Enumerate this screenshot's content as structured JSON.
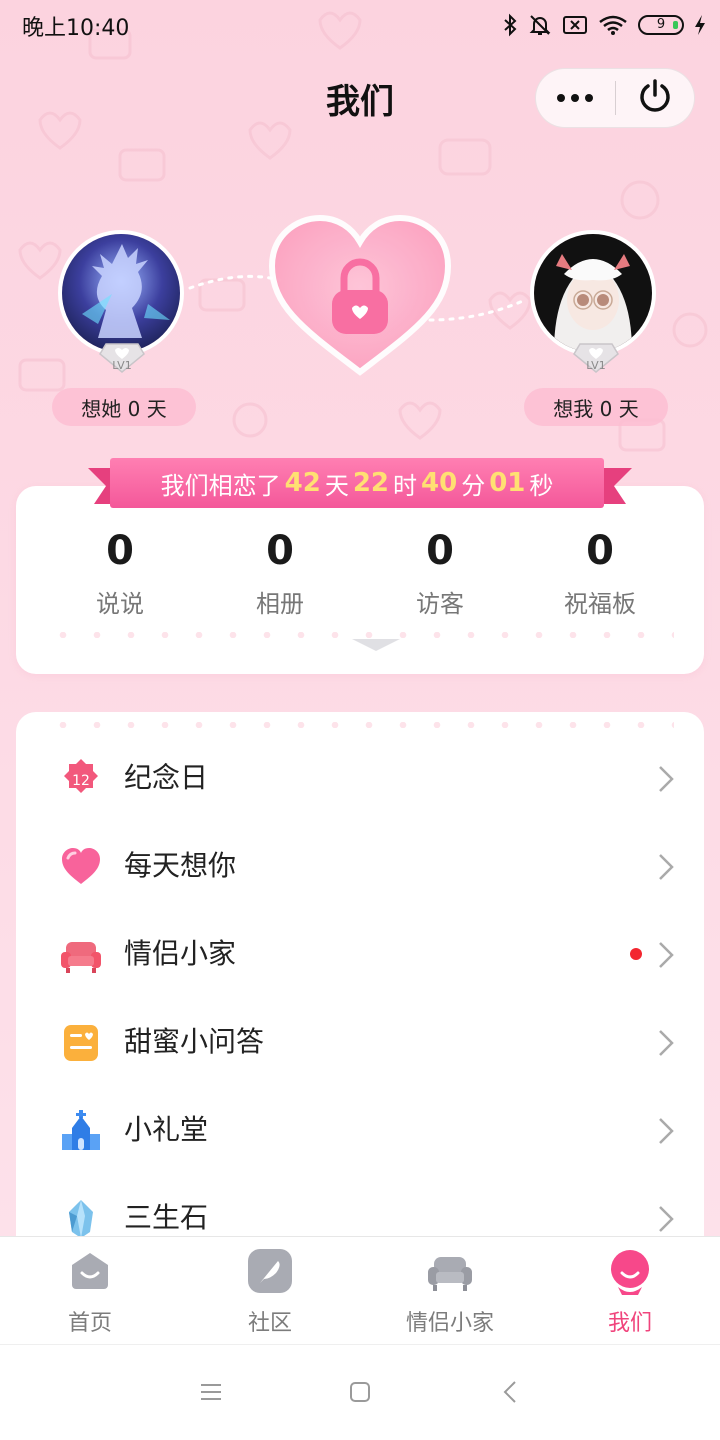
{
  "status_bar": {
    "time": "晚上10:40",
    "battery": "9",
    "icons": [
      "bluetooth-icon",
      "mute-bell-icon",
      "sim-icon",
      "wifi-icon",
      "battery-icon",
      "charging-icon"
    ]
  },
  "header": {
    "title": "我们",
    "more_icon": "more-dots-icon",
    "power_icon": "power-icon"
  },
  "couple": {
    "left": {
      "level": "LV1",
      "days_label": "想她 0 天"
    },
    "right": {
      "level": "LV1",
      "days_label": "想我 0 天"
    },
    "center_icon": "heart-lock-icon"
  },
  "love_timer": {
    "prefix": "我们相恋了",
    "days": "42",
    "days_unit": "天",
    "hours": "22",
    "hours_unit": "时",
    "minutes": "40",
    "minutes_unit": "分",
    "seconds": "01",
    "seconds_unit": "秒"
  },
  "stats": [
    {
      "value": "0",
      "label": "说说"
    },
    {
      "value": "0",
      "label": "相册"
    },
    {
      "value": "0",
      "label": "访客"
    },
    {
      "value": "0",
      "label": "祝福板"
    }
  ],
  "menu": [
    {
      "label": "纪念日",
      "icon": "calendar-12-icon",
      "badge_text": "12"
    },
    {
      "label": "每天想你",
      "icon": "heart-icon"
    },
    {
      "label": "情侣小家",
      "icon": "sofa-icon",
      "has_red_dot": true
    },
    {
      "label": "甜蜜小问答",
      "icon": "qa-card-icon"
    },
    {
      "label": "小礼堂",
      "icon": "chapel-icon"
    },
    {
      "label": "三生石",
      "icon": "crystal-stone-icon"
    }
  ],
  "tabs": [
    {
      "label": "首页",
      "icon": "home-icon",
      "active": false
    },
    {
      "label": "社区",
      "icon": "feather-icon",
      "active": false
    },
    {
      "label": "情侣小家",
      "icon": "sofa-icon",
      "active": false
    },
    {
      "label": "我们",
      "icon": "couple-face-icon",
      "active": true
    }
  ],
  "colors": {
    "accent": "#f0447c",
    "background": "#fdd7e2",
    "timer_number": "#ffe072",
    "ribbon": "#f4589a"
  }
}
